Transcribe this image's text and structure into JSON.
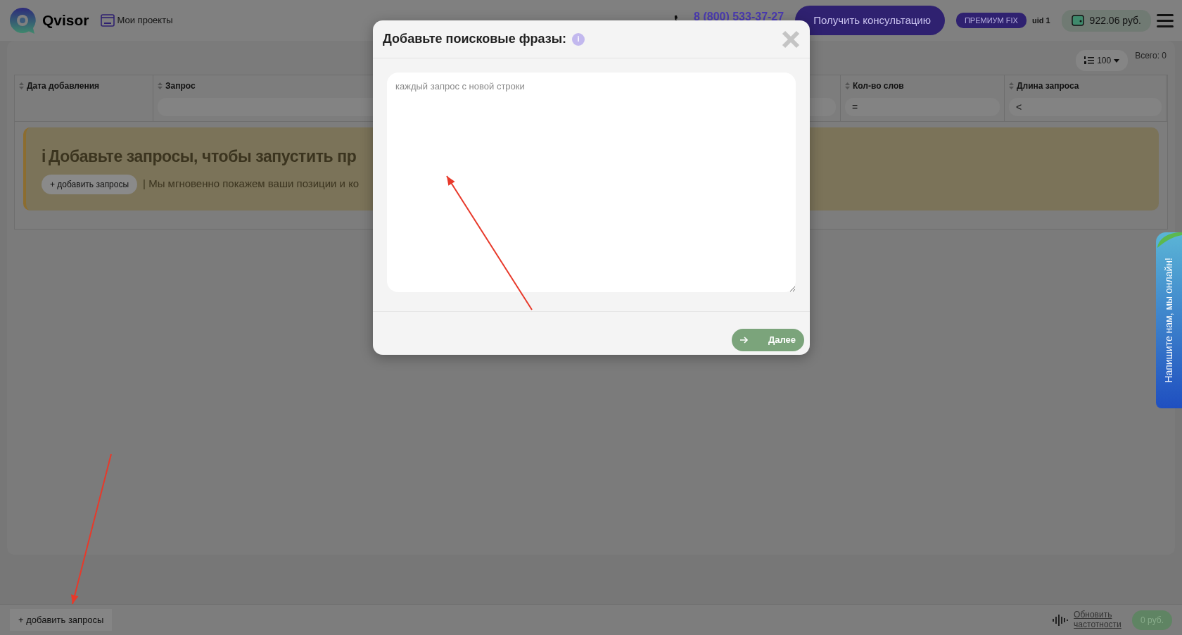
{
  "header": {
    "logo": "Qvisor",
    "projects_link": "Мои проекты",
    "phone": "8 (800) 533-37-27",
    "consult_button": "Получить консультацию",
    "plan_badge": "ПРЕМИУМ FIX",
    "uid": "uid 1",
    "balance": "922.06 руб."
  },
  "toolbar": {
    "page_size": "100",
    "total": "Всего: 0"
  },
  "table": {
    "columns": [
      {
        "label": "Дата добавления",
        "kind": "plain"
      },
      {
        "label": "Запрос",
        "kind": "filter"
      },
      {
        "label": "Кол-во слов",
        "kind": "filter",
        "operator": "="
      },
      {
        "label": "Длина запроса",
        "kind": "filter",
        "operator": "<"
      }
    ]
  },
  "notice": {
    "icon": "i",
    "title": "Добавьте запросы, чтобы запустить пр",
    "add_button": "+ добавить запросы",
    "text": "| Мы мгновенно покажем ваши позиции и ко"
  },
  "modal": {
    "title": "Добавьте поисковые фразы:",
    "info_icon": "i",
    "textarea": {
      "placeholder": "каждый запрос с новой строки"
    },
    "next_button": "Далее"
  },
  "footer": {
    "add_button": "+ добавить запросы",
    "refresh": "Обновить частотности",
    "price": "0 руб."
  },
  "chat_tab": "Напишите нам, мы онлайн!"
}
